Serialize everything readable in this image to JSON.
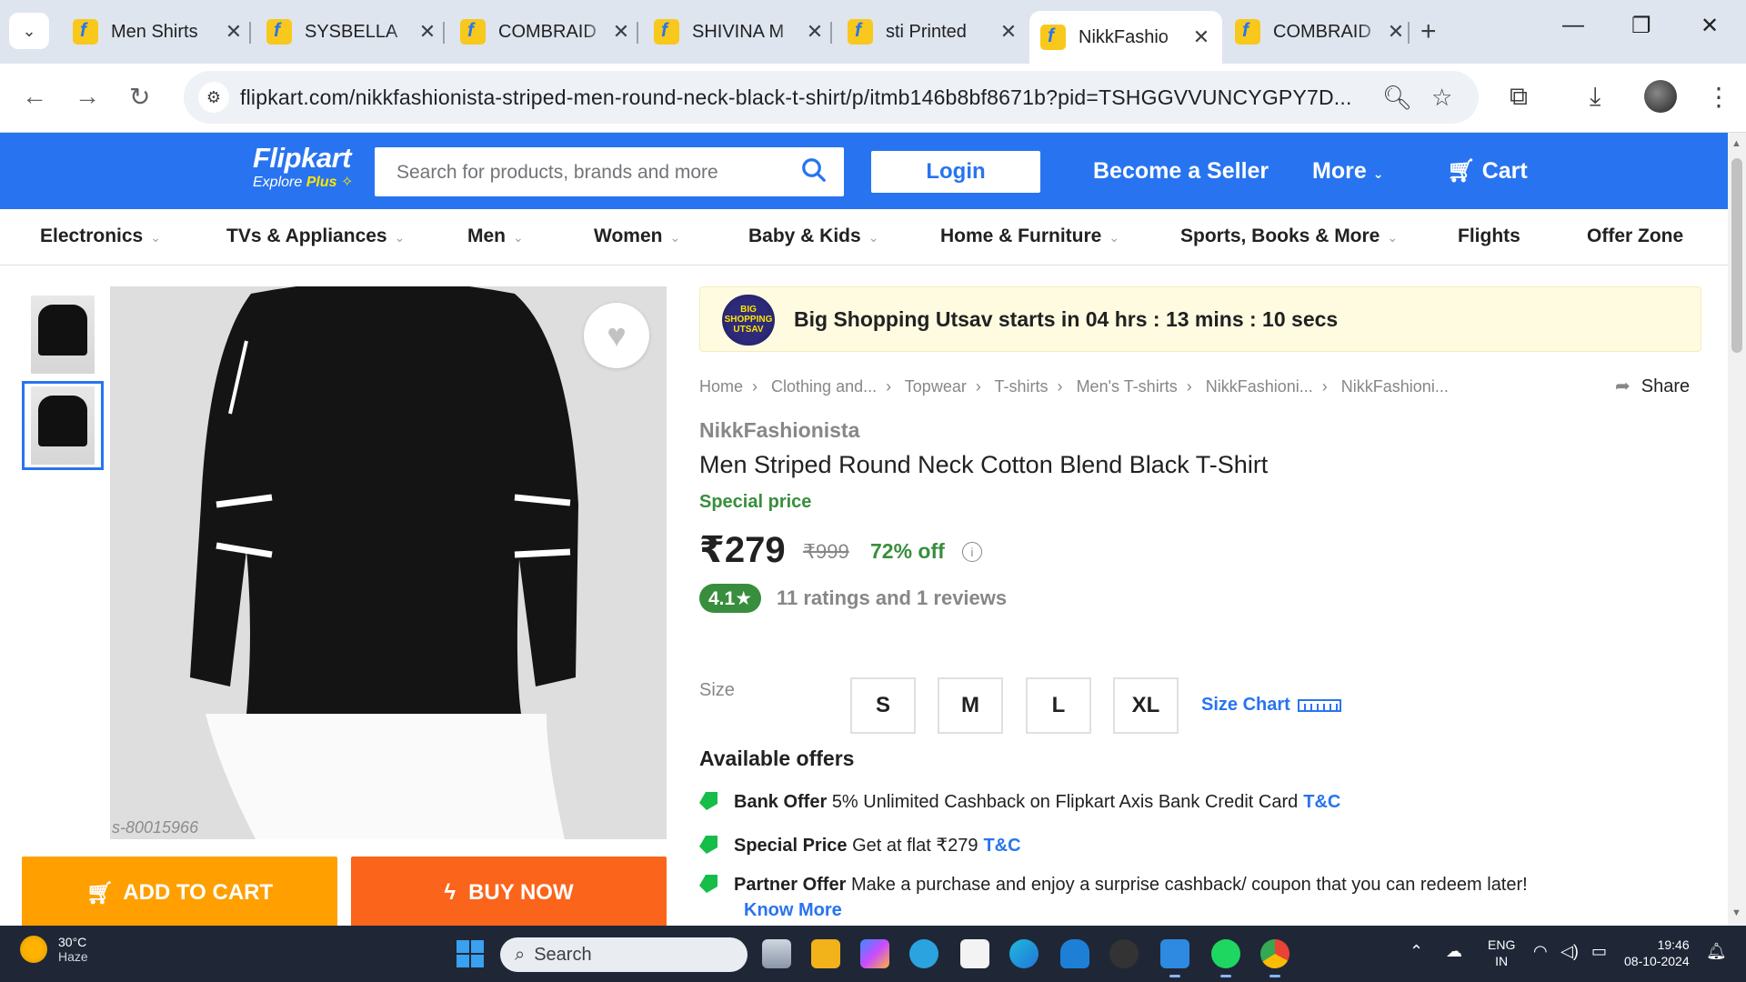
{
  "browser": {
    "tabs": [
      {
        "title": "Men Shirts",
        "active": false
      },
      {
        "title": "SYSBELLA",
        "active": false
      },
      {
        "title": "COMBRAID",
        "active": false
      },
      {
        "title": "SHIVINA M",
        "active": false
      },
      {
        "title": "sti Printed",
        "active": false
      },
      {
        "title": "NikkFashio",
        "active": true
      },
      {
        "title": "COMBRAID",
        "active": false
      }
    ],
    "url": "flipkart.com/nikkfashionista-striped-men-round-neck-black-t-shirt/p/itmb146b8bf8671b?pid=TSHGGVVUNCYGPY7D...",
    "icons": {
      "tab_search": "chevron-down-icon",
      "new_tab": "plus-icon",
      "back": "arrow-left-icon",
      "forward": "arrow-right-icon",
      "reload": "reload-icon",
      "site_info": "tune-icon",
      "zoom": "zoom-icon",
      "bookmark": "star-icon",
      "extensions": "puzzle-icon",
      "downloads": "download-icon",
      "menu": "kebab-menu-icon"
    }
  },
  "flipkart": {
    "logo": {
      "name": "Flipkart",
      "sub_prefix": "Explore ",
      "sub_plus": "Plus"
    },
    "search_placeholder": "Search for products, brands and more",
    "login": "Login",
    "become_seller": "Become a Seller",
    "more": "More",
    "cart": "Cart",
    "categories": [
      "Electronics",
      "TVs & Appliances",
      "Men",
      "Women",
      "Baby & Kids",
      "Home & Furniture",
      "Sports, Books & More",
      "Flights",
      "Offer Zone"
    ],
    "colors": {
      "brand_blue": "#2874f0",
      "add_to_cart": "#ff9f00",
      "buy_now": "#fb641b",
      "green": "#388e3c"
    }
  },
  "product": {
    "watermark": "s-80015966",
    "add_to_cart": "ADD TO CART",
    "buy_now": "BUY NOW",
    "banner_logo": "BIG SHOPPING UTSAV",
    "banner": "Big Shopping Utsav starts in 04 hrs : 13 mins : 10 secs",
    "breadcrumbs": [
      "Home",
      "Clothing and...",
      "Topwear",
      "T-shirts",
      "Men's T-shirts",
      "NikkFashioni...",
      "NikkFashioni..."
    ],
    "share": "Share",
    "brand": "NikkFashionista",
    "title": "Men Striped Round Neck Cotton Blend Black T-Shirt",
    "special_price": "Special price",
    "price": "₹279",
    "mrp": "₹999",
    "discount": "72% off",
    "rating": "4.1★",
    "rating_count": "11 ratings and 1 reviews",
    "size_label": "Size",
    "sizes": [
      "S",
      "M",
      "L",
      "XL"
    ],
    "size_chart": "Size Chart",
    "offers_heading": "Available offers",
    "offers": [
      {
        "type": "Bank Offer",
        "text": "5% Unlimited Cashback on Flipkart Axis Bank Credit Card",
        "link": "T&C"
      },
      {
        "type": "Special Price",
        "text": "Get at flat ₹279",
        "link": "T&C"
      },
      {
        "type": "Partner Offer",
        "text": "Make a purchase and enjoy a surprise cashback/ coupon that you can redeem later!",
        "link": ""
      }
    ],
    "know_more": "Know More"
  },
  "taskbar": {
    "weather_temp": "30°C",
    "weather_desc": "Haze",
    "search": "Search",
    "lang1": "ENG",
    "lang2": "IN",
    "time": "19:46",
    "date": "08-10-2024"
  }
}
